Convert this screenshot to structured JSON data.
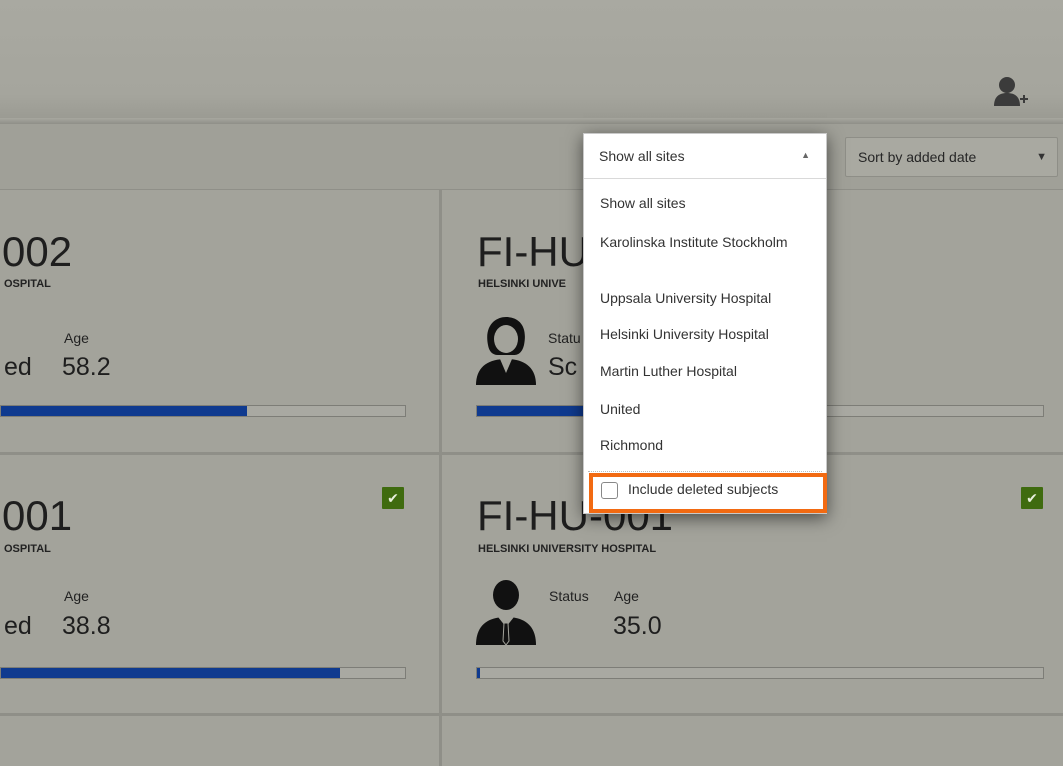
{
  "toolbar": {
    "sort_select": {
      "selected": "Sort by added date"
    },
    "site_filter": {
      "selected": "Show all sites",
      "options": [
        "Show all sites",
        "Karolinska Institute Stockholm",
        "Uppsala University Hospital",
        "Helsinki University Hospital",
        "Martin Luther Hospital",
        "United",
        "Richmond"
      ],
      "include_deleted_label": "Include deleted subjects",
      "include_deleted_checked": false
    }
  },
  "cards": [
    {
      "id": "002",
      "site": "OSPITAL",
      "status_label": "",
      "status_value": "ed",
      "age_label": "Age",
      "age_value": "58.2",
      "progress": 0.61,
      "checked": false
    },
    {
      "id": "FI-HU",
      "site": "HELSINKI UNIVE",
      "status_label": "Statu",
      "status_value": "Sc",
      "age_label": "",
      "age_value": "",
      "progress": 0.2,
      "checked": false
    },
    {
      "id": "001",
      "site": "OSPITAL",
      "status_label": "",
      "status_value": "ed",
      "age_label": "Age",
      "age_value": "38.8",
      "progress": 0.84,
      "checked": true
    },
    {
      "id": "FI-HU-001",
      "site": "HELSINKI UNIVERSITY HOSPITAL",
      "status_label": "Status",
      "status_value": "",
      "age_label": "Age",
      "age_value": "35.0",
      "progress": 0.005,
      "checked": true
    }
  ],
  "colors": {
    "accent": "#0f3a8f",
    "highlight": "#f26a12",
    "check": "#3f6b0f"
  },
  "icons": {
    "add_user": "add-user-icon",
    "avatar_female": "female-avatar-icon",
    "avatar_male": "male-avatar-icon",
    "check": "checkmark-icon"
  }
}
